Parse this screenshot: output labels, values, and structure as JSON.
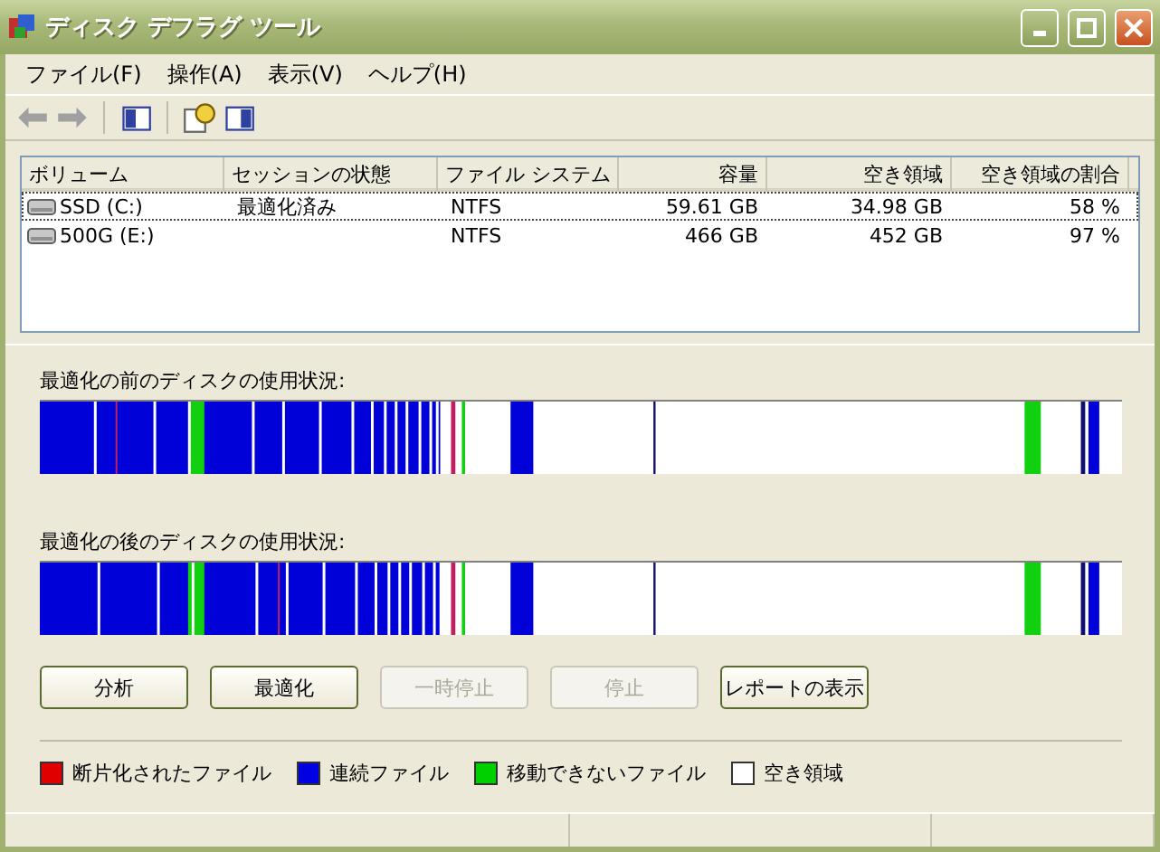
{
  "window": {
    "title": "ディスク デフラグ ツール"
  },
  "menu": [
    "ファイル(F)",
    "操作(A)",
    "表示(V)",
    "ヘルプ(H)"
  ],
  "toolbar": [
    {
      "kind": "back",
      "disabled": true
    },
    {
      "kind": "forward",
      "disabled": true
    },
    {
      "kind": "sep"
    },
    {
      "kind": "panel-left",
      "disabled": false
    },
    {
      "kind": "sep"
    },
    {
      "kind": "help",
      "disabled": false
    },
    {
      "kind": "panel-right",
      "disabled": false
    }
  ],
  "table": {
    "columns": [
      "ボリューム",
      "セッションの状態",
      "ファイル システム",
      "容量",
      "空き領域",
      "空き領域の割合"
    ],
    "rows": [
      {
        "selected": true,
        "cells": [
          "SSD (C:)",
          "最適化済み",
          "NTFS",
          "59.61 GB",
          "34.98 GB",
          "58 %"
        ]
      },
      {
        "selected": false,
        "cells": [
          "500G (E:)",
          "",
          "NTFS",
          "466 GB",
          "452 GB",
          "97 %"
        ]
      }
    ]
  },
  "maps": [
    {
      "label": "最適化の前のディスクの使用状況:"
    },
    {
      "label": "最適化の後のディスクの使用状況:"
    }
  ],
  "buttons": [
    {
      "label": "分析",
      "disabled": false
    },
    {
      "label": "最適化",
      "disabled": false
    },
    {
      "label": "一時停止",
      "disabled": true
    },
    {
      "label": "停止",
      "disabled": true
    },
    {
      "label": "レポートの表示",
      "disabled": false
    }
  ],
  "legend": [
    {
      "label": "断片化されたファイル",
      "color": "#e00000"
    },
    {
      "label": "連続ファイル",
      "color": "#0000e0"
    },
    {
      "label": "移動できないファイル",
      "color": "#00d000"
    },
    {
      "label": "空き領域",
      "color": "#ffffff"
    }
  ]
}
